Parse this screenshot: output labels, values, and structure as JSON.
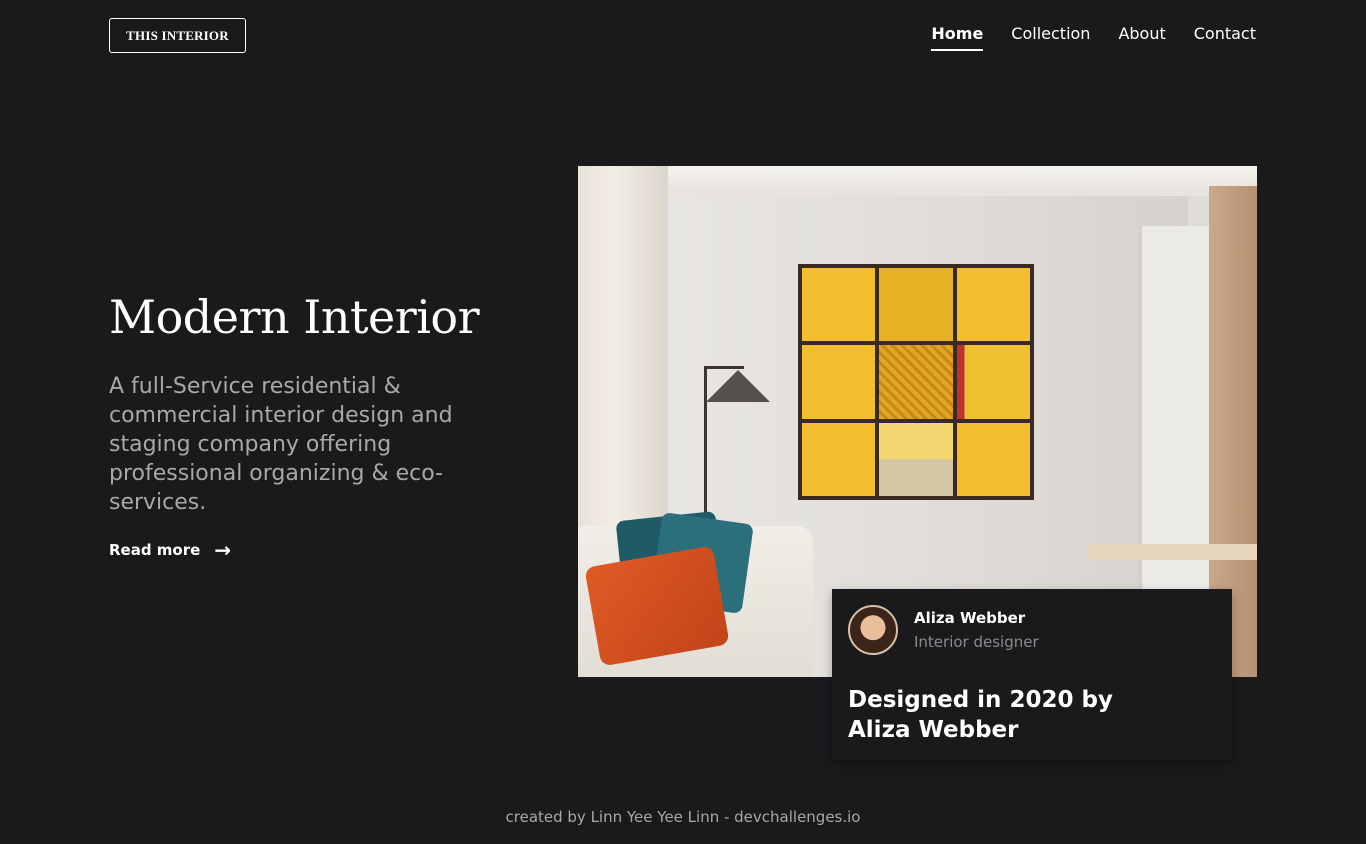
{
  "logo": {
    "text": "THIS INTERIOR"
  },
  "nav": {
    "items": [
      {
        "label": "Home",
        "active": true
      },
      {
        "label": "Collection",
        "active": false
      },
      {
        "label": "About",
        "active": false
      },
      {
        "label": "Contact",
        "active": false
      }
    ]
  },
  "hero": {
    "title": "Modern Interior",
    "description": "A full-Service residential & commercial interior design and staging company offering professional organizing & eco-services.",
    "read_more_label": "Read more",
    "read_more_icon": "arrow-right-icon"
  },
  "card": {
    "author_name": "Aliza Webber",
    "author_role": "Interior designer",
    "headline": "Designed in 2020 by Aliza Webber"
  },
  "footer": {
    "text": "created by Linn Yee Yee Linn - devchallenges.io"
  },
  "colors": {
    "background": "#1a191c",
    "text": "#ffffff",
    "muted": "#a8a8aa"
  }
}
